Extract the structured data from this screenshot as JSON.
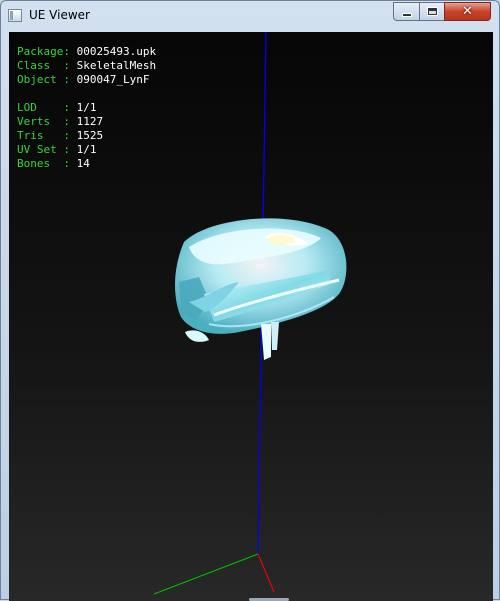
{
  "window": {
    "title": "UE Viewer",
    "controls": {
      "minimize_icon": "minimize-icon",
      "maximize_icon": "maximize-icon",
      "close_glyph": "✕"
    }
  },
  "info": {
    "package": {
      "label": "Package:",
      "value": "00025493.upk"
    },
    "class": {
      "label": "Class  :",
      "value": "SkeletalMesh"
    },
    "object": {
      "label": "Object :",
      "value": "090047_LynF"
    },
    "lod": {
      "label": "LOD    :",
      "value": "1/1"
    },
    "verts": {
      "label": "Verts  :",
      "value": "1127"
    },
    "tris": {
      "label": "Tris   :",
      "value": "1525"
    },
    "uvset": {
      "label": "UV Set :",
      "value": "1/1"
    },
    "bones": {
      "label": "Bones  :",
      "value": "14"
    }
  },
  "colors": {
    "label_green": "#35d635",
    "value_white": "#ffffff",
    "axis_x": "#ff0000",
    "axis_y": "#00c000",
    "axis_z": "#0000ff",
    "mesh_cyan": "#9ff0ff"
  }
}
